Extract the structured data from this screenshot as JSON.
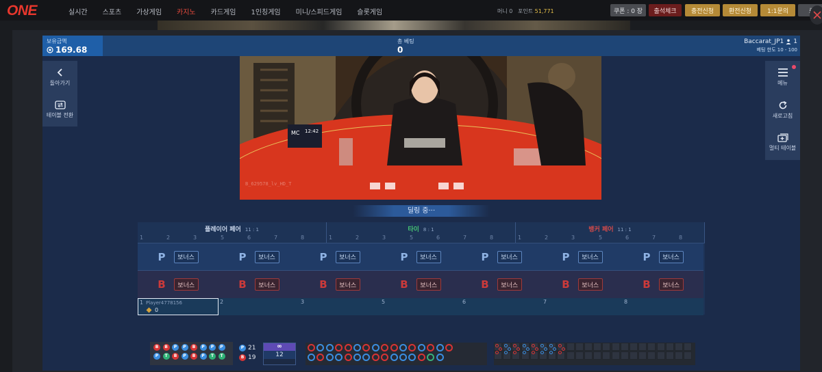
{
  "header": {
    "logo": "ONE",
    "nav": [
      "실시간",
      "스포츠",
      "가상게임",
      "카지노",
      "카드게임",
      "1인칭게임",
      "미니/스피드게임",
      "슬롯게임"
    ],
    "active_nav": "카지노",
    "money_label": "머니 0",
    "point_label": "포인트",
    "point_value": "51,771",
    "coupon_button": "쿠폰 : 0 장",
    "attendance_button": "출석체크",
    "charge_button": "충전신청",
    "exchange_button": "환전신청",
    "inquiry_button": "1:1문의",
    "logout_button": "로"
  },
  "game": {
    "balance_label": "보유금액",
    "balance_value": "169.68",
    "total_bet_label": "총 베팅",
    "total_bet_value": "0",
    "table_name": "Baccarat_JP1",
    "player_count": "1",
    "bet_limit": "베팅 한도 10 - 100",
    "back_label": "돌아가기",
    "switch_table_label": "테이블 전환",
    "menu_label": "메뉴",
    "refresh_label": "새로고침",
    "multi_table_label": "멀티 테이블",
    "video_label": "B_629578_lv_HD_T",
    "status_text": "딜링 중···"
  },
  "board": {
    "pay_sections": [
      {
        "title": "플레이어 페어",
        "odds": "11 : 1",
        "color": "#c9d6ea"
      },
      {
        "title": "타이",
        "odds": "8 : 1",
        "color": "#45c272"
      },
      {
        "title": "뱅커 페어",
        "odds": "11 : 1",
        "color": "#d24a4a"
      }
    ],
    "seat_numbers": [
      "1",
      "2",
      "3",
      "5",
      "6",
      "7",
      "8"
    ],
    "player_letter": "P",
    "banker_letter": "B",
    "bonus_label": "보너스",
    "seat1_name": "Player4778156",
    "seat1_chips": "0"
  },
  "scores": {
    "player_count": "21",
    "banker_count": "19",
    "shoe_symbol": "∞",
    "shoe_number": "12",
    "bead_road": [
      "B",
      "B",
      "P",
      "P",
      "B",
      "P",
      "P",
      "P",
      "P",
      "T",
      "B",
      "P",
      "B",
      "P",
      "T",
      "T"
    ]
  }
}
